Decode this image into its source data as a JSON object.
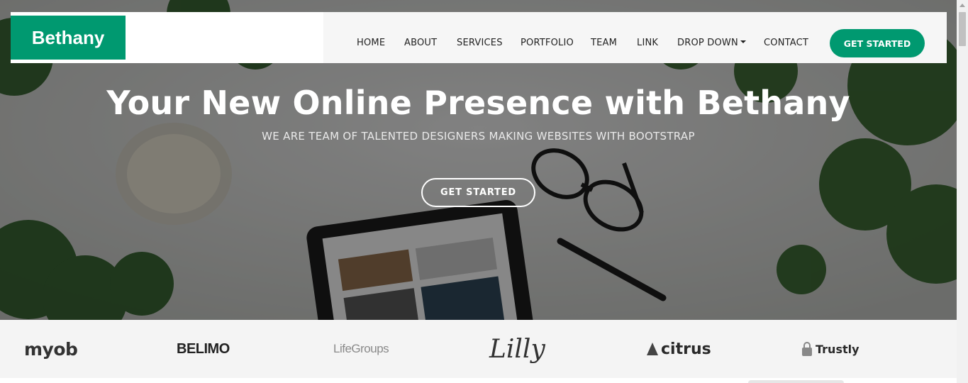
{
  "brand": {
    "name": "Bethany",
    "accent": "#009970"
  },
  "nav": {
    "items": [
      {
        "label": "HOME"
      },
      {
        "label": "ABOUT"
      },
      {
        "label": "SERVICES"
      },
      {
        "label": "PORTFOLIO"
      },
      {
        "label": "TEAM"
      },
      {
        "label": "LINK"
      },
      {
        "label": "DROP DOWN"
      },
      {
        "label": "CONTACT"
      }
    ],
    "cta_label": "GET STARTED"
  },
  "hero": {
    "title": "Your New Online Presence with Bethany",
    "subtitle": "WE ARE TEAM OF TALENTED DESIGNERS MAKING WEBSITES WITH BOOTSTRAP",
    "cta_label": "GET STARTED"
  },
  "clients": [
    {
      "name": "myob"
    },
    {
      "name": "BELIMO"
    },
    {
      "name": "LifeGroups"
    },
    {
      "name": "Lilly"
    },
    {
      "name": "citrus"
    },
    {
      "name": "Trustly"
    }
  ]
}
